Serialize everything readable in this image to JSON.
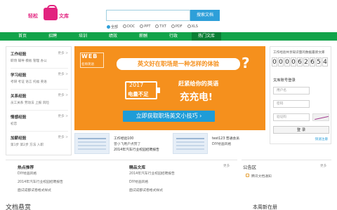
{
  "header": {
    "logo_text_left": "轻松",
    "logo_text_right": "文库",
    "search_placeholder": "",
    "search_button": "搜索文档",
    "filters": [
      "全部",
      "DOC",
      "PPT",
      "TXT",
      "PDF",
      "XLS"
    ],
    "filter_selected": "全部"
  },
  "nav": {
    "items": [
      "首页",
      "招聘",
      "培训",
      "绩效",
      "薪酬",
      "行政",
      "热门文库"
    ],
    "active": "热门文库"
  },
  "sidebar": {
    "more_label": "更多 >",
    "groups": [
      {
        "title": "工作经验",
        "links": "职场  辅导  模板  管理  办公"
      },
      {
        "title": "学习经验",
        "links": "考研  考证  语言  托福  英语"
      },
      {
        "title": "关系经验",
        "links": "员工关系  劳动法  上报  风险"
      },
      {
        "title": "情感经验",
        "links": "初恋"
      },
      {
        "title": "加薪经验",
        "links": "第1步  第2步  方法  入职"
      }
    ]
  },
  "banner": {
    "logo_title": "WEB",
    "logo_subtitle": "名师英语",
    "headline": "英文好在职场是一种怎样的体验",
    "battery_year": "2017",
    "battery_label": "电量不足",
    "right_line1": "赶紧给你的英语",
    "right_line2": "充充电!",
    "cta": "立即获取职场英文小技巧 ›"
  },
  "cards": [
    {
      "line1": "工作经验100",
      "line2": "曾小飞用户点赞了",
      "line3": "2014年汽车行业校园招聘报告"
    },
    {
      "line1": "test123  普通会员",
      "line2": "DIY绘画风格",
      "line3": ""
    }
  ],
  "right_panel": {
    "stat_label": "工作经验共享知识量的数据最新文库",
    "counter": [
      "0",
      "0",
      "0",
      "0",
      "6",
      "2",
      "6",
      "5",
      "4"
    ],
    "login_title": "文库账号登录",
    "username_placeholder": "用户名",
    "password_placeholder": "密码",
    "captcha_placeholder": "验证码",
    "login_button": "登 录",
    "register_link": "快速注册"
  },
  "bottom": {
    "col1": {
      "title": "热点推荐",
      "items": [
        "DIY绘画风格",
        "2014年汽车行业校园招聘报告",
        "面试成都试卷格式样式"
      ]
    },
    "col2": {
      "title": "精品文库",
      "more": "更多",
      "items": [
        "2014年汽车行业校园招聘报告",
        "DIY绘画风格",
        "面试成都试卷格式样式"
      ]
    },
    "col3": {
      "title": "公告区",
      "more": "更多",
      "items": [
        "腾讯文档通知"
      ]
    }
  },
  "sections": {
    "left": "文档悬赏",
    "right": "本周新在册"
  },
  "colors": {
    "nav_green": "#12a34a",
    "banner_orange": "#f5901d",
    "accent_blue": "#2e9fd9",
    "logo_pink": "#e2237f"
  }
}
